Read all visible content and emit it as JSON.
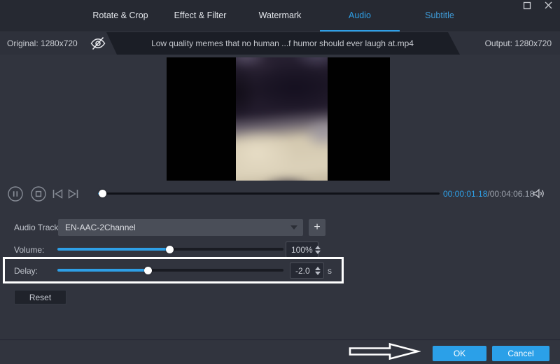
{
  "colors": {
    "accent": "#2e9fe6",
    "panel_bg": "#31343e",
    "tabbar_bg": "#262932",
    "annotation": "#ffffff"
  },
  "tabs": [
    {
      "label": "Rotate & Crop",
      "active": false
    },
    {
      "label": "Effect & Filter",
      "active": false
    },
    {
      "label": "Watermark",
      "active": false
    },
    {
      "label": "Audio",
      "active": true
    },
    {
      "label": "Subtitle",
      "active": false
    }
  ],
  "info_bar": {
    "original": "Original: 1280x720",
    "filename": "Low quality memes that no human ...f humor should ever laugh at.mp4",
    "output": "Output: 1280x720"
  },
  "player": {
    "current_time": "00:00:01.18",
    "time_separator": "/",
    "total_time": "00:04:06.18"
  },
  "audio_panel": {
    "track_label": "Audio Track:",
    "track_value": "EN-AAC-2Channel",
    "add_button": "+",
    "volume_label": "Volume:",
    "volume_value": "100%",
    "delay_label": "Delay:",
    "delay_value": "-2.0",
    "delay_unit": "s",
    "reset_button": "Reset"
  },
  "footer": {
    "ok": "OK",
    "cancel": "Cancel"
  },
  "sliders": {
    "seek_fill_style": "width:1.2%",
    "volume_fill_style": "width:49.5%",
    "delay_fill_style": "width:40%"
  },
  "icons": {
    "eye_hidden": "preview-visibility-off",
    "volume": "speaker-with-waves"
  }
}
